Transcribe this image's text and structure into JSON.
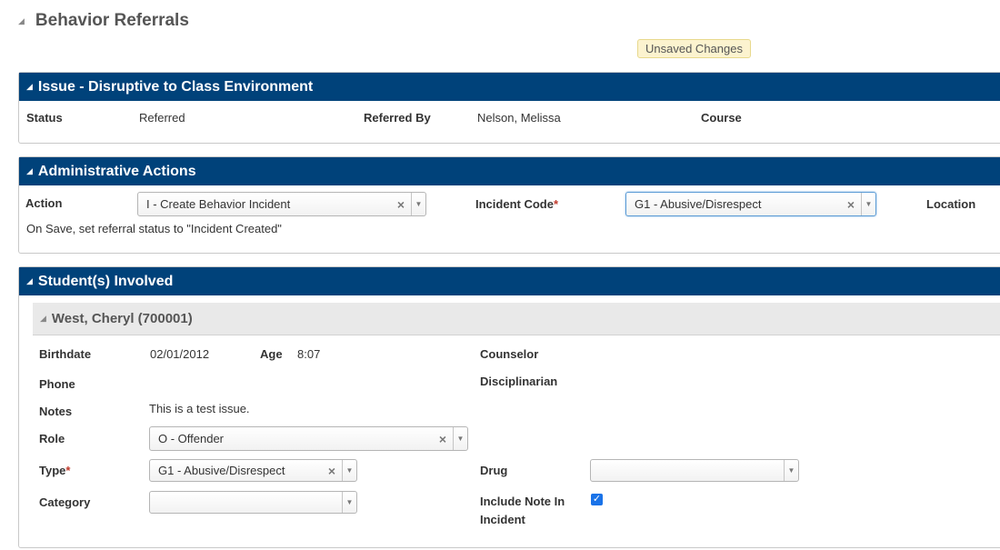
{
  "page": {
    "title": "Behavior Referrals",
    "badge": "Unsaved Changes"
  },
  "issue_panel": {
    "title": "Issue - Disruptive to Class Environment",
    "status_label": "Status",
    "status_value": "Referred",
    "referred_by_label": "Referred By",
    "referred_by_value": "Nelson, Melissa",
    "course_label": "Course"
  },
  "admin_panel": {
    "title": "Administrative Actions",
    "action_label": "Action",
    "action_value": "I - Create Behavior Incident",
    "incident_code_label": "Incident Code",
    "incident_code_value": "G1 - Abusive/Disrespect",
    "location_label": "Location",
    "note": "On Save, set referral status to \"Incident Created\""
  },
  "students_panel": {
    "title": "Student(s) Involved",
    "student": {
      "header": "West, Cheryl (700001)",
      "birthdate_label": "Birthdate",
      "birthdate_value": "02/01/2012",
      "age_label": "Age",
      "age_value": "8:07",
      "counselor_label": "Counselor",
      "phone_label": "Phone",
      "disciplinarian_label": "Disciplinarian",
      "notes_label": "Notes",
      "notes_value": "This is a test issue.",
      "role_label": "Role",
      "role_value": "O - Offender",
      "type_label": "Type",
      "type_value": "G1 - Abusive/Disrespect",
      "drug_label": "Drug",
      "drug_value": "",
      "category_label": "Category",
      "category_value": "",
      "include_note_label_line1": "Include Note In",
      "include_note_label_line2": "Incident",
      "include_note_checked": true
    }
  },
  "icons": {
    "collapse": "collapse-triangle-icon",
    "clear": "clear-x-icon",
    "dropdown": "dropdown-arrow-icon",
    "check": "checkmark-icon"
  },
  "colors": {
    "header_bg": "#00427a",
    "badge_bg": "#fcf3cf",
    "checkbox": "#1a73e8",
    "required": "#c0392b"
  }
}
